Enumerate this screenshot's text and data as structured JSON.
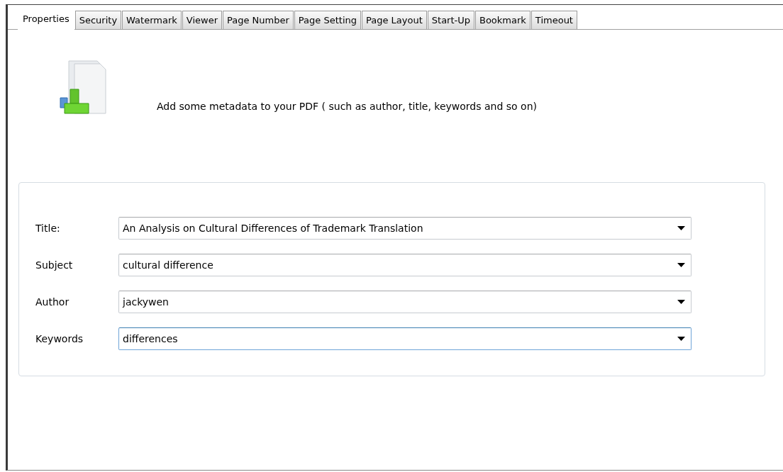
{
  "tabs": [
    {
      "label": "Properties",
      "selected": true
    },
    {
      "label": "Security",
      "selected": false
    },
    {
      "label": "Watermark",
      "selected": false
    },
    {
      "label": "Viewer",
      "selected": false
    },
    {
      "label": "Page Number",
      "selected": false
    },
    {
      "label": "Page Setting",
      "selected": false
    },
    {
      "label": "Page Layout",
      "selected": false
    },
    {
      "label": "Start-Up",
      "selected": false
    },
    {
      "label": "Bookmark",
      "selected": false
    },
    {
      "label": "Timeout",
      "selected": false
    }
  ],
  "description": "Add some metadata to your PDF ( such as author, title, keywords and so on)",
  "fields": [
    {
      "label": "Title:",
      "value": "An Analysis on Cultural Differences of Trademark Translation",
      "focused": false
    },
    {
      "label": "Subject",
      "value": "cultural difference",
      "focused": false
    },
    {
      "label": "Author",
      "value": "jackywen",
      "focused": false
    },
    {
      "label": "Keywords",
      "value": "differences",
      "focused": true
    }
  ]
}
